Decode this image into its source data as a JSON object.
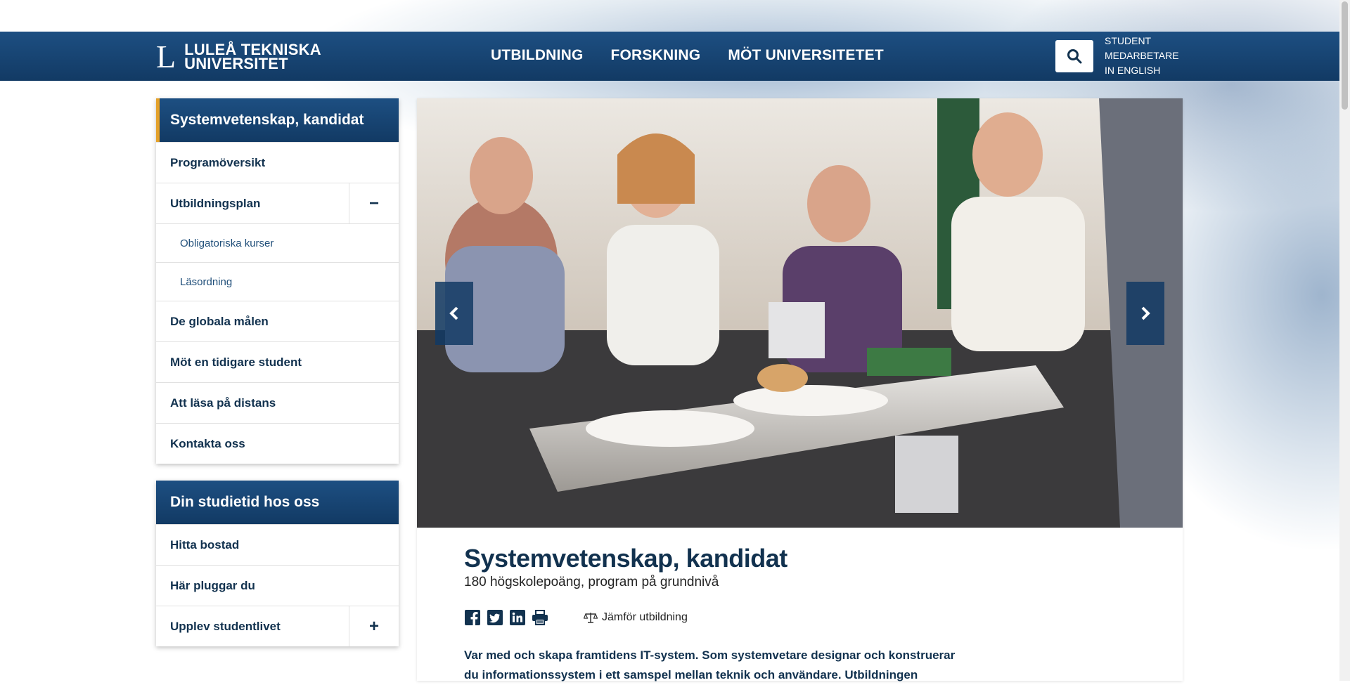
{
  "header": {
    "logo_mark": "L",
    "logo_line1": "LULEÅ TEKNISKA",
    "logo_line2": "UNIVERSITET",
    "nav": [
      "UTBILDNING",
      "FORSKNING",
      "MÖT UNIVERSITETET"
    ],
    "utility": [
      "STUDENT",
      "MEDARBETARE",
      "IN ENGLISH"
    ]
  },
  "sidebar": {
    "title": "Systemvetenskap, kandidat",
    "items": [
      {
        "label": "Programöversikt"
      },
      {
        "label": "Utbildningsplan",
        "toggle": "−"
      },
      {
        "label": "Obligatoriska kurser"
      },
      {
        "label": "Läsordning"
      },
      {
        "label": "De globala målen"
      },
      {
        "label": "Möt en tidigare student"
      },
      {
        "label": "Att läsa på distans"
      },
      {
        "label": "Kontakta oss"
      }
    ]
  },
  "sidebar2": {
    "title": "Din studietid hos oss",
    "items": [
      {
        "label": "Hitta bostad"
      },
      {
        "label": "Här pluggar du"
      },
      {
        "label": "Upplev studentlivet",
        "toggle": "+"
      }
    ]
  },
  "main": {
    "title": "Systemvetenskap, kandidat",
    "subtitle": "180 högskolepoäng, program på grundnivå",
    "compare_label": "Jämför utbildning",
    "intro": "Var med och skapa framtidens IT-system. Som systemvetare designar och konstruerar du informationssystem i ett samspel mellan teknik och användare. Utbildningen"
  },
  "colors": {
    "brand_dark": "#123a64",
    "brand": "#1d4f82",
    "accent": "#e4a12a",
    "text_dark": "#12324f"
  },
  "icons": [
    "search-icon",
    "facebook-icon",
    "twitter-icon",
    "linkedin-icon",
    "print-icon",
    "scales-icon",
    "chevron-left-icon",
    "chevron-right-icon"
  ]
}
